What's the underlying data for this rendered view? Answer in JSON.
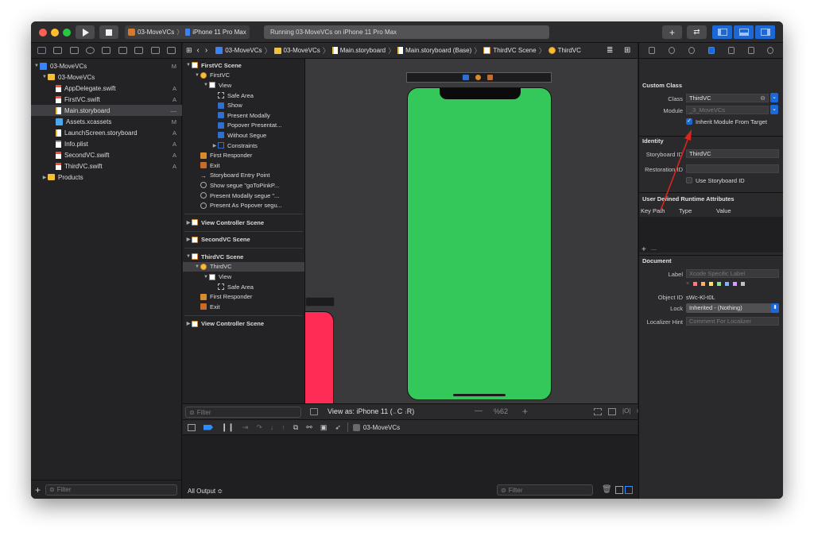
{
  "toolbar": {
    "scheme_target": "03-MoveVCs",
    "scheme_device": "iPhone 11 Pro Max",
    "activity_status": "Running 03-MoveVCs on iPhone 11 Pro Max",
    "add_label": "+",
    "swap_label": "⇄"
  },
  "navigator": {
    "items": [
      {
        "label": "03-MoveVCs",
        "badge": "M",
        "icon": "project-icon",
        "level": 0,
        "disclosure": "▼"
      },
      {
        "label": "03-MoveVCs",
        "badge": "",
        "icon": "folder-icon",
        "level": 1,
        "disclosure": "▼"
      },
      {
        "label": "AppDelegate.swift",
        "badge": "A",
        "icon": "swift-file-icon",
        "level": 2,
        "disclosure": ""
      },
      {
        "label": "FirstVC.swift",
        "badge": "A",
        "icon": "swift-file-icon",
        "level": 2,
        "disclosure": ""
      },
      {
        "label": "Main.storyboard",
        "badge": "—",
        "icon": "storyboard-file-icon",
        "level": 2,
        "disclosure": "",
        "selected": true
      },
      {
        "label": "Assets.xcassets",
        "badge": "M",
        "icon": "assets-icon",
        "level": 2,
        "disclosure": ""
      },
      {
        "label": "LaunchScreen.storyboard",
        "badge": "A",
        "icon": "storyboard-file-icon",
        "level": 2,
        "disclosure": ""
      },
      {
        "label": "Info.plist",
        "badge": "A",
        "icon": "plist-file-icon",
        "level": 2,
        "disclosure": ""
      },
      {
        "label": "SecondVC.swift",
        "badge": "A",
        "icon": "swift-file-icon",
        "level": 2,
        "disclosure": ""
      },
      {
        "label": "ThirdVC.swift",
        "badge": "A",
        "icon": "swift-file-icon",
        "level": 2,
        "disclosure": ""
      },
      {
        "label": "Products",
        "badge": "",
        "icon": "folder-icon",
        "level": 1,
        "disclosure": "▶"
      }
    ],
    "filter_placeholder": "Filter"
  },
  "jumpbar": {
    "crumbs": [
      "03-MoveVCs",
      "03-MoveVCs",
      "Main.storyboard",
      "Main.storyboard (Base)",
      "ThirdVC Scene",
      "ThirdVC"
    ]
  },
  "outline": {
    "rows": [
      {
        "label": "FirstVC Scene",
        "level": 0,
        "disclosure": "▼",
        "icon": "scene-icon",
        "bold": true
      },
      {
        "label": "FirstVC",
        "level": 1,
        "disclosure": "▼",
        "icon": "view-controller-icon"
      },
      {
        "label": "View",
        "level": 2,
        "disclosure": "▼",
        "icon": "view-icon"
      },
      {
        "label": "Safe Area",
        "level": 3,
        "disclosure": "",
        "icon": "safe-area-icon"
      },
      {
        "label": "Show",
        "level": 3,
        "disclosure": "",
        "icon": "button-icon"
      },
      {
        "label": "Present Modally",
        "level": 3,
        "disclosure": "",
        "icon": "button-icon"
      },
      {
        "label": "Popover Presentat...",
        "level": 3,
        "disclosure": "",
        "icon": "button-icon"
      },
      {
        "label": "Without Segue",
        "level": 3,
        "disclosure": "",
        "icon": "button-icon"
      },
      {
        "label": "Constraints",
        "level": 3,
        "disclosure": "▶",
        "icon": "constraints-icon"
      },
      {
        "label": "First Responder",
        "level": 1,
        "disclosure": "",
        "icon": "first-responder-icon"
      },
      {
        "label": "Exit",
        "level": 1,
        "disclosure": "",
        "icon": "exit-icon"
      },
      {
        "label": "Storyboard Entry Point",
        "level": 1,
        "disclosure": "",
        "icon": "arrow-right-icon"
      },
      {
        "label": "Show segue \"goToPinkP...",
        "level": 1,
        "disclosure": "",
        "icon": "segue-icon"
      },
      {
        "label": "Present Modally segue \"...",
        "level": 1,
        "disclosure": "",
        "icon": "segue-icon"
      },
      {
        "label": "Present As Popover segu...",
        "level": 1,
        "disclosure": "",
        "icon": "segue-icon"
      },
      {
        "sep": true
      },
      {
        "label": "View Controller Scene",
        "level": 0,
        "disclosure": "▶",
        "icon": "scene-icon",
        "bold": true
      },
      {
        "sep": true
      },
      {
        "label": "SecondVC Scene",
        "level": 0,
        "disclosure": "▶",
        "icon": "scene-icon",
        "bold": true
      },
      {
        "sep": true
      },
      {
        "label": "ThirdVC Scene",
        "level": 0,
        "disclosure": "▼",
        "icon": "scene-icon",
        "bold": true
      },
      {
        "label": "ThirdVC",
        "level": 1,
        "disclosure": "▼",
        "icon": "view-controller-icon",
        "selected": true
      },
      {
        "label": "View",
        "level": 2,
        "disclosure": "▼",
        "icon": "view-icon"
      },
      {
        "label": "Safe Area",
        "level": 3,
        "disclosure": "",
        "icon": "safe-area-icon"
      },
      {
        "label": "First Responder",
        "level": 1,
        "disclosure": "",
        "icon": "first-responder-icon"
      },
      {
        "label": "Exit",
        "level": 1,
        "disclosure": "",
        "icon": "exit-icon"
      },
      {
        "sep": true
      },
      {
        "label": "View Controller Scene",
        "level": 0,
        "disclosure": "▶",
        "icon": "scene-icon",
        "bold": true
      }
    ],
    "filter_placeholder": "Filter"
  },
  "canvas_bar": {
    "view_as": "View as: iPhone 11 (",
    "view_as_mid": "C",
    "view_as_end": "R)",
    "zoom_minus": "—",
    "zoom": "%62",
    "zoom_plus": "+"
  },
  "debug": {
    "target_label": "03-MoveVCs",
    "output_select": "All Output ≎",
    "filter_placeholder": "Filter"
  },
  "inspector": {
    "custom_class": {
      "header": "Custom Class",
      "class_label": "Class",
      "class_value": "ThirdVC",
      "module_label": "Module",
      "module_value": "_3_MoveVCs",
      "inherit_label": "Inherit Module From Target"
    },
    "identity": {
      "header": "Identity",
      "storyboard_id_label": "Storyboard ID",
      "storyboard_id_value": "ThirdVC",
      "restoration_id_label": "Restoration ID",
      "use_storyboard_id_label": "Use Storyboard ID"
    },
    "runtime_attrs": {
      "header": "User Defined Runtime Attributes",
      "col_key": "Key Path",
      "col_type": "Type",
      "col_value": "Value",
      "add": "+",
      "remove": "—"
    },
    "document": {
      "header": "Document",
      "label_label": "Label",
      "label_placeholder": "Xcode Specific Label",
      "label_x": "×",
      "object_id_label": "Object ID",
      "object_id_value": "sWc-Kl-t0L",
      "lock_label": "Lock",
      "lock_value": "Inherited - (Nothing)",
      "localizer_label": "Localizer Hint",
      "localizer_placeholder": "Comment For Localizer"
    }
  },
  "colors": {
    "green_view": "#34c759",
    "pink_view": "#ff2d55",
    "accent": "#1c68d6",
    "annotation_arrow": "#d9251c"
  }
}
